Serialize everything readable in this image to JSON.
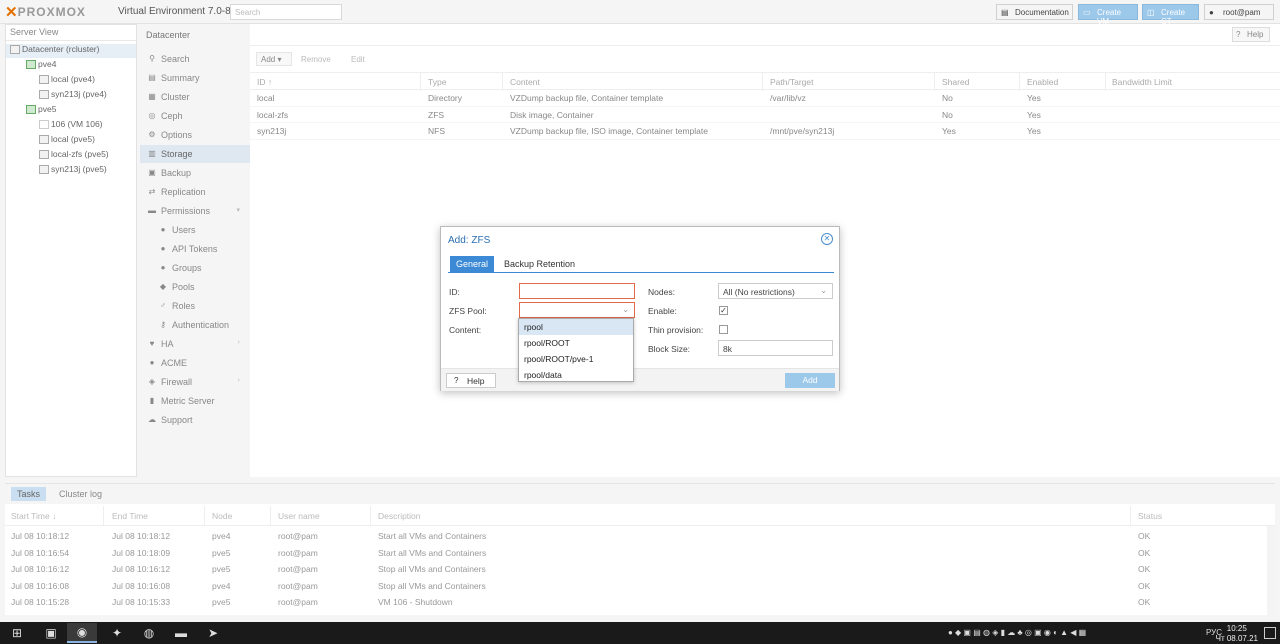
{
  "topbar": {
    "brand": "PROXMOX",
    "version": "Virtual Environment 7.0-8",
    "search_placeholder": "Search",
    "documentation": "Documentation",
    "create_vm": "Create VM",
    "create_ct": "Create CT",
    "user": "root@pam"
  },
  "tree": {
    "view": "Server View",
    "items": [
      {
        "label": "Datacenter (rcluster)"
      },
      {
        "label": "pve4"
      },
      {
        "label": "local (pve4)"
      },
      {
        "label": "syn213j (pve4)"
      },
      {
        "label": "pve5"
      },
      {
        "label": "106 (VM 106)"
      },
      {
        "label": "local (pve5)"
      },
      {
        "label": "local-zfs (pve5)"
      },
      {
        "label": "syn213j (pve5)"
      }
    ]
  },
  "nav": {
    "breadcrumb": "Datacenter",
    "items": [
      {
        "label": "Search"
      },
      {
        "label": "Summary"
      },
      {
        "label": "Cluster"
      },
      {
        "label": "Ceph"
      },
      {
        "label": "Options"
      },
      {
        "label": "Storage"
      },
      {
        "label": "Backup"
      },
      {
        "label": "Replication"
      },
      {
        "label": "Permissions"
      },
      {
        "label": "Users"
      },
      {
        "label": "API Tokens"
      },
      {
        "label": "Groups"
      },
      {
        "label": "Pools"
      },
      {
        "label": "Roles"
      },
      {
        "label": "Authentication"
      },
      {
        "label": "HA"
      },
      {
        "label": "ACME"
      },
      {
        "label": "Firewall"
      },
      {
        "label": "Metric Server"
      },
      {
        "label": "Support"
      }
    ]
  },
  "storage": {
    "help": "Help",
    "toolbar": {
      "add": "Add",
      "remove": "Remove",
      "edit": "Edit"
    },
    "columns": [
      "ID ↑",
      "Type",
      "Content",
      "Path/Target",
      "Shared",
      "Enabled",
      "Bandwidth Limit"
    ],
    "rows": [
      [
        "local",
        "Directory",
        "VZDump backup file, Container template",
        "/var/lib/vz",
        "No",
        "Yes",
        ""
      ],
      [
        "local-zfs",
        "ZFS",
        "Disk image, Container",
        "",
        "No",
        "Yes",
        ""
      ],
      [
        "syn213j",
        "NFS",
        "VZDump backup file, ISO image, Container template",
        "/mnt/pve/syn213j",
        "Yes",
        "Yes",
        ""
      ]
    ]
  },
  "tasks": {
    "tabs": [
      "Tasks",
      "Cluster log"
    ],
    "columns": [
      "Start Time ↓",
      "End Time",
      "Node",
      "User name",
      "Description",
      "Status"
    ],
    "rows": [
      [
        "Jul 08 10:18:12",
        "Jul 08 10:18:12",
        "pve4",
        "root@pam",
        "Start all VMs and Containers",
        "OK"
      ],
      [
        "Jul 08 10:16:54",
        "Jul 08 10:18:09",
        "pve5",
        "root@pam",
        "Start all VMs and Containers",
        "OK"
      ],
      [
        "Jul 08 10:16:12",
        "Jul 08 10:16:12",
        "pve5",
        "root@pam",
        "Stop all VMs and Containers",
        "OK"
      ],
      [
        "Jul 08 10:16:08",
        "Jul 08 10:16:08",
        "pve4",
        "root@pam",
        "Stop all VMs and Containers",
        "OK"
      ],
      [
        "Jul 08 10:15:28",
        "Jul 08 10:15:33",
        "pve5",
        "root@pam",
        "VM 106 - Shutdown",
        "OK"
      ]
    ]
  },
  "dialog": {
    "title": "Add: ZFS",
    "tabs": [
      "General",
      "Backup Retention"
    ],
    "id_label": "ID:",
    "id_value": "",
    "pool_label": "ZFS Pool:",
    "pool_value": "",
    "content_label": "Content:",
    "nodes_label": "Nodes:",
    "nodes_value": "All (No restrictions)",
    "enable_label": "Enable:",
    "enable_checked": true,
    "thin_label": "Thin provision:",
    "thin_checked": false,
    "blocksize_label": "Block Size:",
    "blocksize_value": "8k",
    "help": "Help",
    "add": "Add",
    "pool_options": [
      "rpool",
      "rpool/ROOT",
      "rpool/ROOT/pve-1",
      "rpool/data"
    ]
  },
  "taskbar": {
    "lang": "РУС",
    "time": "10:25",
    "date": "Чт 08.07.21"
  }
}
